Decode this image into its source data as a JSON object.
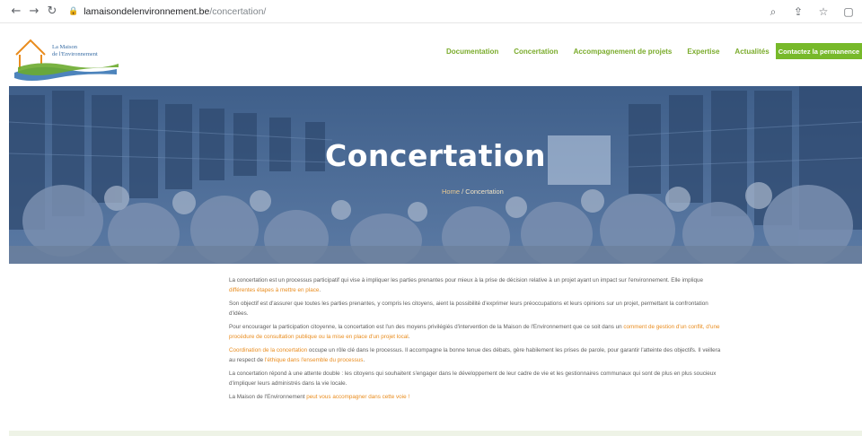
{
  "browser": {
    "url_host": "lamaisondelenvironnement.be",
    "url_path": "/concertation/"
  },
  "header": {
    "logo_line1": "La Maison",
    "logo_line2": "de l'Environnement",
    "menu": [
      "Documentation",
      "Concertation",
      "Accompagnement de projets",
      "Expertise",
      "Actualités"
    ],
    "cta_label": "Contactez la permanence"
  },
  "hero": {
    "title": "Concertation",
    "breadcrumb_home": "Home",
    "breadcrumb_sep": "/",
    "breadcrumb_current": "Concertation"
  },
  "content": {
    "p1_text": "La concertation est un processus participatif qui vise à impliquer les parties prenantes pour mieux à la prise de décision relative à un projet ayant un impact sur l'environnement. Elle implique ",
    "p1_link": "différentes étapes à mettre en place",
    "p1_end": ".",
    "p2_text": "Son objectif est d'assurer que toutes les parties prenantes, y compris les citoyens, aient la possibilité d'exprimer leurs préoccupations et leurs opinions sur un projet, permettant la confrontation d'idées.",
    "p3_text": "Pour encourager la participation citoyenne, la concertation est l'un des moyens privilégiés d'intervention de la Maison de l'Environnement que ce soit dans un ",
    "p3_link": "comment de gestion d'un conflit, d'une procédure de consultation publique ou la mise en place d'un projet local",
    "p3_end": ".",
    "p4_link": "Coordination de la concertation",
    "p4_text": " occupe un rôle clé dans le processus. Il accompagne la bonne tenue des débats, gère habilement les prises de parole, pour garantir l'atteinte des objectifs. Il veillera au respect de ",
    "p4_link2": "l'éthique dans l'ensemble du processus",
    "p4_end": ".",
    "p5_text": "La concertation répond à une attente double : les citoyens qui souhaitent s'engager dans le développement de leur cadre de vie et les gestionnaires communaux qui sont de plus en plus soucieux d'impliquer leurs administrés dans la vie locale.",
    "p6_text": "La Maison de l'Environnement ",
    "p6_link": "peut vous accompagner dans cette voie !"
  },
  "colors": {
    "menu_green": "#7aab2b",
    "cta_green": "#77b92a",
    "link_orange": "#e98c1e",
    "hero_overlay": "#4a6c98"
  },
  "icons": [
    "back-arrow-icon",
    "forward-arrow-icon",
    "reload-icon",
    "lock-icon",
    "zoom-icon",
    "share-icon",
    "star-icon",
    "sidebar-icon"
  ]
}
